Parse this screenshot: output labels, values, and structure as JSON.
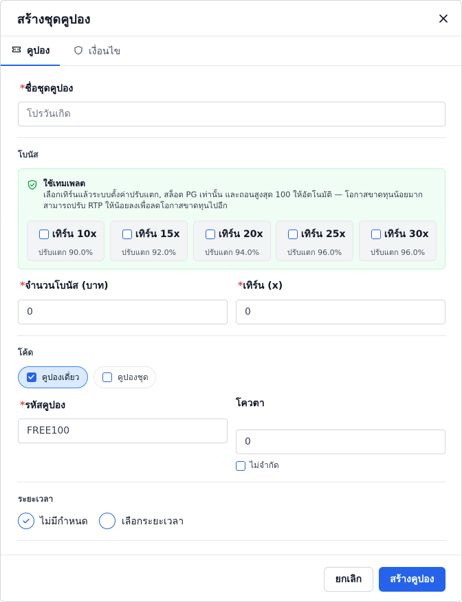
{
  "modal": {
    "title": "สร้างชุดคูปอง"
  },
  "tabs": [
    {
      "label": "คูปอง",
      "icon": "ticket-icon",
      "active": true
    },
    {
      "label": "เงื่อนไข",
      "icon": "shield-icon",
      "active": false
    }
  ],
  "form": {
    "name_label": "ชื่อชุดคูปอง",
    "name_placeholder": "โปรวันเกิด",
    "bonus_section": "โบนัส",
    "template": {
      "title": "ใช้เทมเพลต",
      "description": "เลือกเทิร์นแล้วระบบตั้งค่าปรับแตก, สล็อต PG เท่านั้น และถอนสูงสุด 100 ให้อัตโนมัติ — โอกาสขาดทุนน้อยมาก สามารถปรับ RTP ให้น้อยลงเพื่อลดโอกาสขาดทุนไปอีก",
      "options": [
        {
          "label": "เทิร์น 10x",
          "sub": "ปรับแตก 90.0%"
        },
        {
          "label": "เทิร์น 15x",
          "sub": "ปรับแตก 92.0%"
        },
        {
          "label": "เทิร์น 20x",
          "sub": "ปรับแตก 94.0%"
        },
        {
          "label": "เทิร์น 25x",
          "sub": "ปรับแตก 96.0%"
        },
        {
          "label": "เทิร์น 30x",
          "sub": "ปรับแตก 96.0%"
        }
      ]
    },
    "bonus_amount_label": "จำนวนโบนัส (บาท)",
    "bonus_amount_value": "0",
    "turnover_label": "เทิร์น (x)",
    "turnover_value": "0",
    "code_section": "โค้ด",
    "code_types": [
      {
        "label": "คูปองเดี่ยว",
        "checked": true
      },
      {
        "label": "คูปองชุด",
        "checked": false
      }
    ],
    "coupon_code_label": "รหัสคูปอง",
    "coupon_code_value": "FREE100",
    "quota_label": "โควตา",
    "quota_value": "0",
    "unlimited_label": "ไม่จำกัด",
    "duration_section": "ระยะเวลา",
    "duration_options": [
      {
        "label": "ไม่มีกำหนด",
        "checked": true
      },
      {
        "label": "เลือกระยะเวลา",
        "checked": false
      }
    ]
  },
  "footer": {
    "cancel_label": "ยกเลิก",
    "create_label": "สร้างคูปอง"
  },
  "colors": {
    "primary": "#2563eb",
    "required": "#ef4444",
    "success_bg": "#f0fdf4",
    "success_border": "#bbf7d0",
    "success_icon": "#16a34a"
  }
}
